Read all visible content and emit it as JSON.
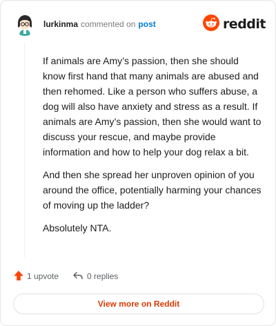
{
  "header": {
    "username": "lurkinma",
    "action_text": "commented on",
    "post_link": "post",
    "brand": "reddit"
  },
  "comment": {
    "paragraphs": [
      "If animals are Amy’s passion, then she should know first hand that many animals are abused and then rehomed. Like a person who suffers abuse, a dog will also have anxiety and stress as a result. If animals are Amy’s passion, then she would want to discuss your rescue, and maybe provide information and how to help your dog relax a bit.",
      "And then she spread her unproven opinion of you around the office, potentially harming your chances of moving up the ladder?",
      "Absolutely NTA."
    ]
  },
  "footer": {
    "upvotes": "1 upvote",
    "replies": "0 replies"
  },
  "view_more": "View more on Reddit",
  "colors": {
    "brand_orange": "#ff4500",
    "link_blue": "#0079d3",
    "cta_text": "#d93a00"
  },
  "icons": {
    "avatar": "avatar-icon",
    "brand": "reddit-logo-icon",
    "upvote": "upvote-arrow-icon",
    "reply": "reply-arrow-icon"
  }
}
